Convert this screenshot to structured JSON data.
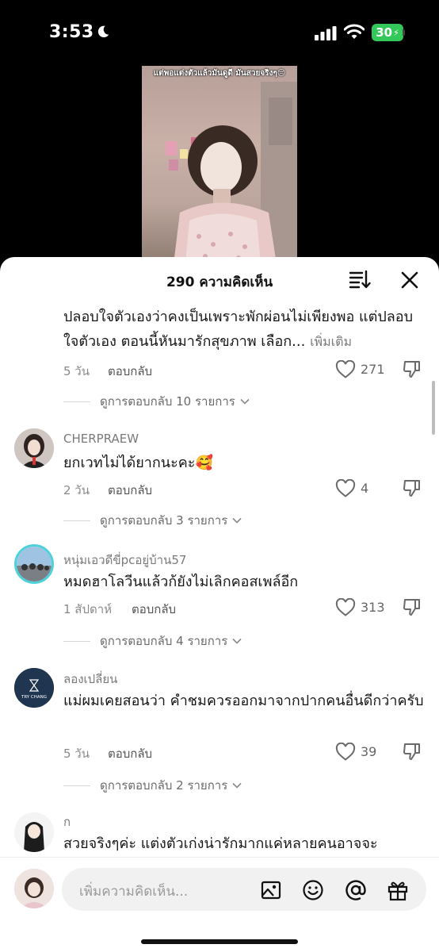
{
  "status_bar": {
    "time": "3:53",
    "battery": "30"
  },
  "video": {
    "caption": "แต่พอแต่งตัวแล้วมันดูดี มันสวยจริงๆ😔"
  },
  "sheet": {
    "title": "290 ความคิดเห็น"
  },
  "comments": [
    {
      "username": "",
      "text": "ปลอบใจตัวเองว่าคงเป็นเพราะพักผ่อนไม่เพียงพอ แต่ปลอบใจตัวเอง ตอนนี้หันมารักสุขภาพ เลือก...",
      "more_label": "เพิ่มเติม",
      "time": "5 วัน",
      "reply_label": "ตอบกลับ",
      "likes": "271",
      "view_replies": "ดูการตอบกลับ 10 รายการ"
    },
    {
      "username": "CHERPRAEW",
      "text": "ยกเวทไม่ได้ยากนะคะ🥰",
      "time": "2 วัน",
      "reply_label": "ตอบกลับ",
      "likes": "4",
      "view_replies": "ดูการตอบกลับ 3 รายการ"
    },
    {
      "username": "หนุ่มเอวดีขี่pcอยู่บ้าน57",
      "text": "หมดฮาโลวีนแล้วก้ยังไม่เลิกคอสเพล์อีก",
      "time": "1 สัปดาห์",
      "reply_label": "ตอบกลับ",
      "likes": "313",
      "view_replies": "ดูการตอบกลับ 4 รายการ"
    },
    {
      "username": "ลองเปลี่ยน",
      "avatar_text": "TRY CHANG",
      "text": "แม่ผมเคยสอนว่า คำชมควรออกมาจากปากคนอื่นดีกว่าครับ",
      "time": "5 วัน",
      "reply_label": "ตอบกลับ",
      "likes": "39",
      "view_replies": "ดูการตอบกลับ 2 รายการ"
    },
    {
      "username": "ก",
      "text": "สวยจริงๆค่ะ แต่งตัวเก่งน่ารักมากแค่หลายคนอาจจะ"
    }
  ],
  "input": {
    "placeholder": "เพิ่มความคิดเห็น..."
  },
  "icons": {
    "moon": "moon-icon",
    "signal": "cellular-signal-icon",
    "wifi": "wifi-icon",
    "sort": "sort-icon",
    "close": "close-icon",
    "like": "heart-icon",
    "dislike": "thumbs-down-icon",
    "image": "image-icon",
    "emoji": "smiley-icon",
    "mention": "at-sign-icon",
    "gift": "gift-icon"
  }
}
